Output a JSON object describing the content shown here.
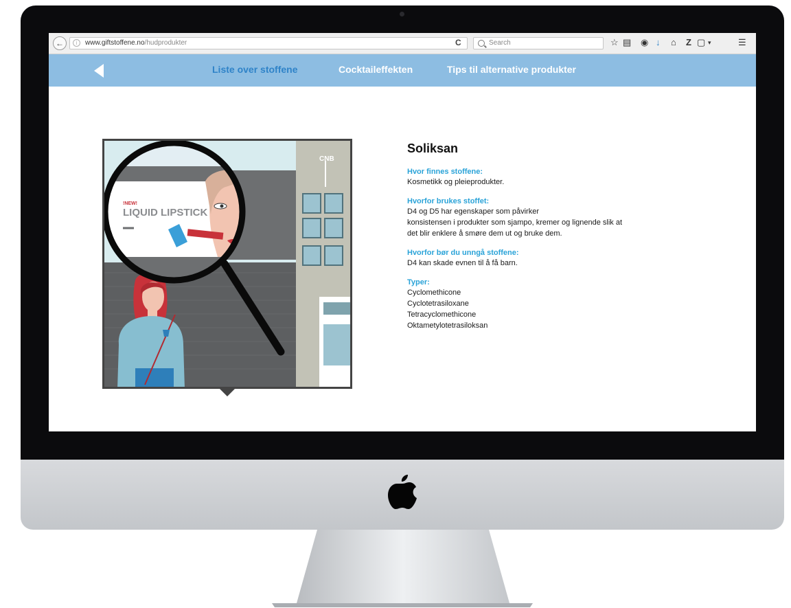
{
  "browser": {
    "url_domain": "www.giftstoffene.no",
    "url_path": "/hudprodukter",
    "search_placeholder": "Search"
  },
  "nav": {
    "items": [
      {
        "label": "Liste over stoffene",
        "active": true
      },
      {
        "label": "Cocktaileffekten",
        "active": false
      },
      {
        "label": "Tips til alternative produkter",
        "active": false
      }
    ]
  },
  "illustration": {
    "billboard_new": "!NEW!",
    "billboard_title": "LIQUID LIPSTICK",
    "building_sign": "CNB"
  },
  "substance": {
    "name": "Soliksan",
    "sections": [
      {
        "heading": "Hvor finnes stoffene:",
        "lines": [
          "Kosmetikk og pleieprodukter."
        ]
      },
      {
        "heading": "Hvorfor brukes stoffet:",
        "lines": [
          "D4 og D5 har egenskaper som påvirker",
          "konsistensen i produkter som sjampo, kremer og lignende slik at",
          "det blir enklere å smøre dem ut og bruke dem."
        ]
      },
      {
        "heading": "Hvorfor bør du unngå stoffene:",
        "lines": [
          "D4 kan skade evnen til å få barn."
        ]
      },
      {
        "heading": "Typer:",
        "lines": [
          "Cyclomethicone",
          "Cyclotetrasiloxane",
          "Tetracyclomethicone",
          "Oktametylotetrasiloksan"
        ]
      }
    ]
  },
  "colors": {
    "nav_bg": "#8dbde2",
    "nav_active": "#2f83c8",
    "section_heading": "#2aa3d8"
  }
}
